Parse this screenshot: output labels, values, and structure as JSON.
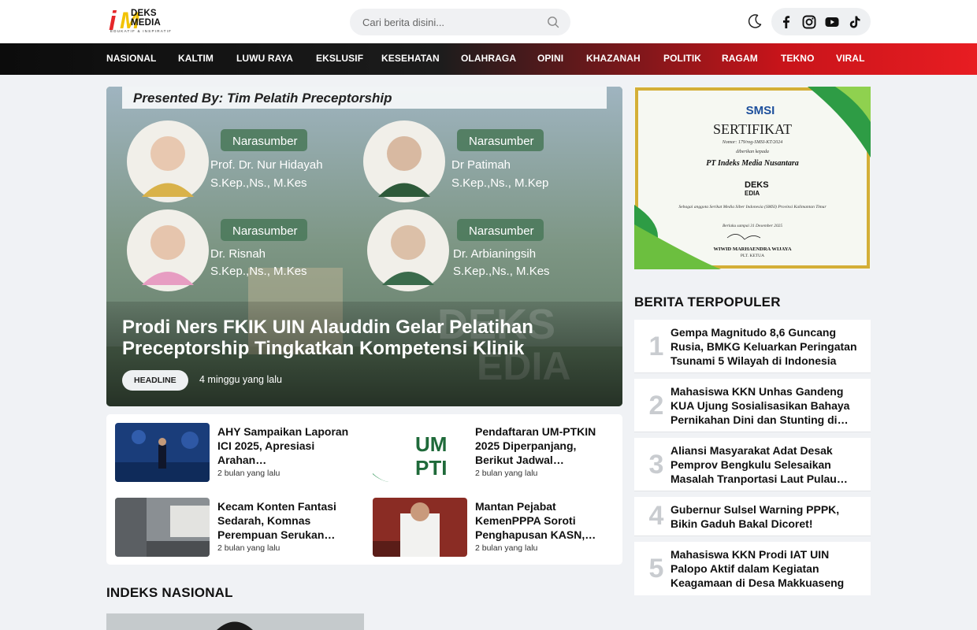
{
  "header": {
    "logo_big": "i",
    "logo_big2": "M",
    "logo_text": "DEKS MEDIA",
    "logo_tagline": "EDUKATIF & INSPIRATIF",
    "search_placeholder": "Cari berita disini...",
    "social": [
      "facebook-icon",
      "instagram-icon",
      "youtube-icon",
      "tiktok-icon"
    ]
  },
  "nav": [
    "NASIONAL",
    "KALTIM",
    "LUWU RAYA",
    "EKSLUSIF",
    "KESEHATAN",
    "OLAHRAGA",
    "OPINI",
    "KHAZANAH",
    "POLITIK",
    "RAGAM",
    "TEKNO",
    "VIRAL"
  ],
  "hero": {
    "title": "Prodi Ners FKIK UIN Alauddin Gelar Pelatihan Preceptorship Tingkatkan Kompetensi Klinik",
    "category": "HEADLINE",
    "time": "4 minggu yang lalu",
    "image": {
      "presented": "Presented By: Tim Pelatih Preceptorship",
      "speaker_label": "Narasumber",
      "speakers": [
        {
          "name": "Prof. Dr. Nur Hidayah",
          "title": "S.Kep.,Ns., M.Kes"
        },
        {
          "name": "Dr Patimah",
          "title": "S.Kep.,Ns., M.Kep"
        },
        {
          "name": "Dr. Risnah",
          "title": "S.Kep.,Ns., M.Kes"
        },
        {
          "name": "Dr. Arbianingsih",
          "title": "S.Kep.,Ns., M.Kes"
        }
      ]
    }
  },
  "news": [
    {
      "title": "AHY Sampaikan Laporan ICI 2025, Apresiasi Arahan…",
      "time": "2 bulan yang lalu"
    },
    {
      "title": "Pendaftaran UM-PTKIN 2025 Diperpanjang, Berikut Jadwal…",
      "time": "2 bulan yang lalu"
    },
    {
      "title": "Kecam Konten Fantasi Sedarah, Komnas Perempuan Serukan…",
      "time": "2 bulan yang lalu"
    },
    {
      "title": "Mantan Pejabat KemenPPPA Soroti Penghapusan KASN,…",
      "time": "2 bulan yang lalu"
    }
  ],
  "index_title": "INDEKS NASIONAL",
  "sidebar": {
    "cert": {
      "org": "SMSI",
      "heading": "SERTIFIKAT",
      "number": "Nomor: 179/reg-SMSI-KT/2024",
      "given": "diberikan kepada",
      "company": "PT Indeks Media Nusantara",
      "member": "Sebagai anggota Serikat Media Siber Indonesia (SMSI) Provinsi Kalimantan Timur",
      "valid": "Berlaku sampai 31 Desember 2025",
      "signer": "WIWID MARHAENDRA WIJAYA",
      "signer_title": "PLT. KETUA"
    },
    "popular_title": "BERITA TERPOPULER",
    "popular": [
      {
        "num": "1",
        "title": "Gempa Magnitudo 8,6 Guncang Rusia, BMKG Keluarkan Peringatan Tsunami 5 Wilayah di Indonesia"
      },
      {
        "num": "2",
        "title": "Mahasiswa KKN Unhas Gandeng KUA Ujung Sosialisasikan Bahaya Pernikahan Dini dan Stunting di…"
      },
      {
        "num": "3",
        "title": "Aliansi Masyarakat Adat Desak Pemprov Bengkulu Selesaikan Masalah Tranportasi Laut Pulau…"
      },
      {
        "num": "4",
        "title": "Gubernur Sulsel Warning PPPK, Bikin Gaduh Bakal Dicoret!"
      },
      {
        "num": "5",
        "title": "Mahasiswa KKN Prodi IAT UIN Palopo Aktif dalam Kegiatan Keagamaan di Desa Makkuaseng"
      }
    ]
  }
}
